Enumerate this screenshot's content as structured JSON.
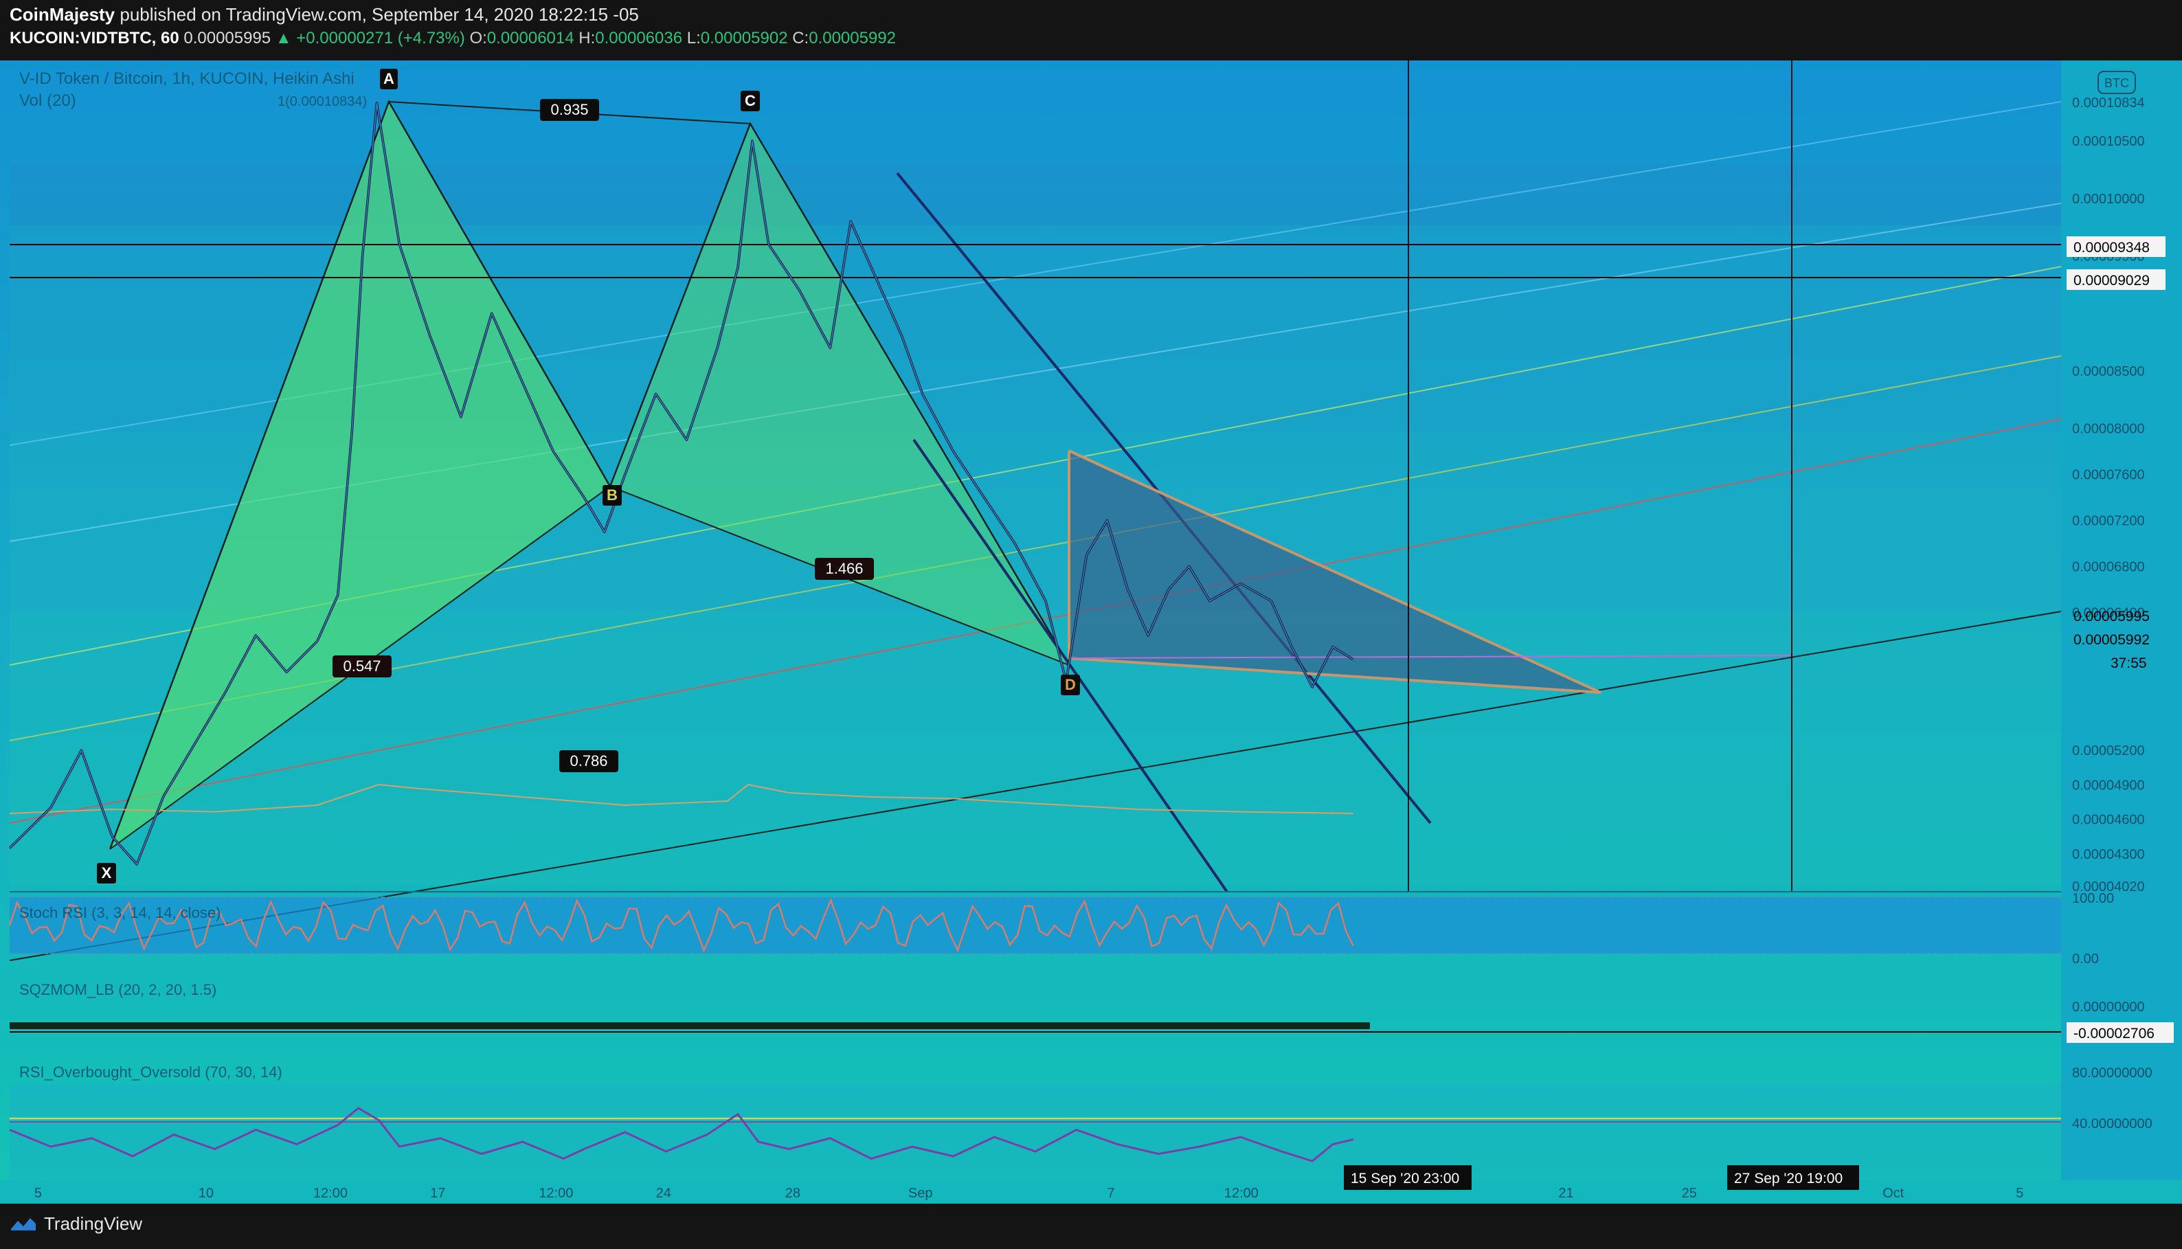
{
  "header": {
    "publisher": "CoinMajesty",
    "published_text": "published on TradingView.com, September 14, 2020 18:22:15 -05",
    "symbol": "KUCOIN:VIDTBTC, 60",
    "last": "0.00005995",
    "change": "▲ +0.00000271 (+4.73%)",
    "o_label": "O:",
    "o": "0.00006014",
    "h_label": "H:",
    "h": "0.00006036",
    "l_label": "L:",
    "l": "0.00005902",
    "c_label": "C:",
    "c": "0.00005992"
  },
  "legend": {
    "title": "V-ID Token / Bitcoin, 1h, KUCOIN, Heikin Ashi",
    "vol": "Vol (20)",
    "fib_label": "1(0.00010834)",
    "currency_badge": "BTC"
  },
  "footer": {
    "brand": "TradingView"
  },
  "colors": {
    "background": "#141414",
    "chart_fill_top": "#1a9fd6",
    "chart_fill_bottom": "#14c2b8",
    "pattern_fill": "#4fd67a",
    "pattern_line": "#1b2a2a",
    "triangle_fill": "#3b6e8e",
    "triangle_edge": "#c9956a",
    "resistance_line": "#000000",
    "channel_line": "#1a2a6e",
    "red_line": "#d05a5a",
    "yellow_line": "#d6d34a",
    "rsi_line": "#7a3ea8",
    "stoch_line": "#d97a6a"
  },
  "chart_data": {
    "type": "line",
    "title": "V-ID Token / Bitcoin, 1h, KUCOIN, Heikin Ashi",
    "price_axis_ticks": [
      "0.00010834",
      "0.00010500",
      "0.00010000",
      "0.00009500",
      "0.00008500",
      "0.00008000",
      "0.00007600",
      "0.00007200",
      "0.00006800",
      "0.00006400",
      "0.00005200",
      "0.00004900",
      "0.00004600",
      "0.00004300",
      "0.00004020"
    ],
    "price_labels": [
      {
        "value": "0.00009348",
        "kind": "hline"
      },
      {
        "value": "0.00009029",
        "kind": "hline"
      },
      {
        "value": "0.00005995",
        "kind": "last"
      },
      {
        "value": "0.00005992",
        "kind": "close"
      },
      {
        "value": "37:55",
        "kind": "countdown"
      }
    ],
    "time_axis_ticks": [
      "5",
      "10",
      "12:00",
      "17",
      "12:00",
      "24",
      "28",
      "Sep",
      "7",
      "12:00",
      "21",
      "25",
      "Oct",
      "5"
    ],
    "time_markers": [
      "15 Sep '20   23:00",
      "27 Sep '20   19:00"
    ],
    "harmonic_points": [
      "X",
      "A",
      "B",
      "C",
      "D"
    ],
    "harmonic_ratios": [
      "0.935",
      "0.547",
      "1.466",
      "0.786"
    ],
    "indicators": [
      {
        "name": "Stoch RSI (3, 3, 14, 14, close)",
        "ticks": [
          "100.00",
          "0.00"
        ]
      },
      {
        "name": "SQZMOM_LB (20, 2, 20, 1.5)",
        "ticks": [
          "0.00000000"
        ],
        "value": "-0.00002706"
      },
      {
        "name": "RSI_Overbought_Oversold (70, 30, 14)",
        "ticks": [
          "80.00000000",
          "40.00000000"
        ]
      }
    ],
    "price_path": [
      [
        0.0,
        4.35e-05
      ],
      [
        0.02,
        4.7e-05
      ],
      [
        0.035,
        5.2e-05
      ],
      [
        0.05,
        4.45e-05
      ],
      [
        0.062,
        4.21e-05
      ],
      [
        0.075,
        4.8e-05
      ],
      [
        0.09,
        5.25e-05
      ],
      [
        0.105,
        5.7e-05
      ],
      [
        0.12,
        6.2e-05
      ],
      [
        0.135,
        5.88e-05
      ],
      [
        0.15,
        6.15e-05
      ],
      [
        0.16,
        6.55e-05
      ],
      [
        0.167,
        8e-05
      ],
      [
        0.172,
        9.5e-05
      ],
      [
        0.179,
        0.0001083
      ],
      [
        0.19,
        9.6e-05
      ],
      [
        0.205,
        8.8e-05
      ],
      [
        0.22,
        8.1e-05
      ],
      [
        0.235,
        9e-05
      ],
      [
        0.25,
        8.4e-05
      ],
      [
        0.265,
        7.8e-05
      ],
      [
        0.28,
        7.4e-05
      ],
      [
        0.29,
        7.1e-05
      ],
      [
        0.3,
        7.6e-05
      ],
      [
        0.315,
        8.3e-05
      ],
      [
        0.33,
        7.9e-05
      ],
      [
        0.345,
        8.7e-05
      ],
      [
        0.355,
        9.4e-05
      ],
      [
        0.362,
        0.000105
      ],
      [
        0.37,
        9.6e-05
      ],
      [
        0.385,
        9.2e-05
      ],
      [
        0.4,
        8.7e-05
      ],
      [
        0.41,
        9.8e-05
      ],
      [
        0.42,
        9.4e-05
      ],
      [
        0.435,
        8.8e-05
      ],
      [
        0.445,
        8.3e-05
      ],
      [
        0.46,
        7.8e-05
      ],
      [
        0.475,
        7.4e-05
      ],
      [
        0.49,
        7e-05
      ],
      [
        0.505,
        6.5e-05
      ],
      [
        0.515,
        5.8e-05
      ],
      [
        0.525,
        6.9e-05
      ],
      [
        0.535,
        7.2e-05
      ],
      [
        0.545,
        6.6e-05
      ],
      [
        0.555,
        6.2e-05
      ],
      [
        0.565,
        6.6e-05
      ],
      [
        0.575,
        6.8e-05
      ],
      [
        0.585,
        6.5e-05
      ],
      [
        0.6,
        6.65e-05
      ],
      [
        0.615,
        6.5e-05
      ],
      [
        0.625,
        6.1e-05
      ],
      [
        0.635,
        5.75e-05
      ],
      [
        0.645,
        6.1e-05
      ],
      [
        0.655,
        5.99e-05
      ]
    ],
    "volume_ma": [
      [
        0.0,
        0.2
      ],
      [
        0.05,
        0.25
      ],
      [
        0.1,
        0.22
      ],
      [
        0.15,
        0.3
      ],
      [
        0.18,
        0.55
      ],
      [
        0.2,
        0.5
      ],
      [
        0.25,
        0.4
      ],
      [
        0.3,
        0.3
      ],
      [
        0.35,
        0.35
      ],
      [
        0.36,
        0.55
      ],
      [
        0.38,
        0.45
      ],
      [
        0.42,
        0.4
      ],
      [
        0.46,
        0.38
      ],
      [
        0.5,
        0.32
      ],
      [
        0.55,
        0.25
      ],
      [
        0.6,
        0.22
      ],
      [
        0.655,
        0.2
      ]
    ],
    "rsi_path": [
      [
        0.0,
        62
      ],
      [
        0.02,
        48
      ],
      [
        0.04,
        55
      ],
      [
        0.06,
        40
      ],
      [
        0.08,
        58
      ],
      [
        0.1,
        46
      ],
      [
        0.12,
        62
      ],
      [
        0.14,
        50
      ],
      [
        0.16,
        66
      ],
      [
        0.17,
        80
      ],
      [
        0.18,
        70
      ],
      [
        0.19,
        48
      ],
      [
        0.21,
        55
      ],
      [
        0.23,
        42
      ],
      [
        0.25,
        52
      ],
      [
        0.27,
        38
      ],
      [
        0.28,
        46
      ],
      [
        0.3,
        60
      ],
      [
        0.32,
        44
      ],
      [
        0.34,
        58
      ],
      [
        0.355,
        75
      ],
      [
        0.365,
        52
      ],
      [
        0.38,
        46
      ],
      [
        0.4,
        55
      ],
      [
        0.42,
        38
      ],
      [
        0.44,
        48
      ],
      [
        0.46,
        40
      ],
      [
        0.48,
        56
      ],
      [
        0.5,
        44
      ],
      [
        0.52,
        62
      ],
      [
        0.54,
        50
      ],
      [
        0.56,
        42
      ],
      [
        0.58,
        48
      ],
      [
        0.6,
        56
      ],
      [
        0.62,
        44
      ],
      [
        0.635,
        36
      ],
      [
        0.645,
        50
      ],
      [
        0.655,
        54
      ]
    ]
  }
}
